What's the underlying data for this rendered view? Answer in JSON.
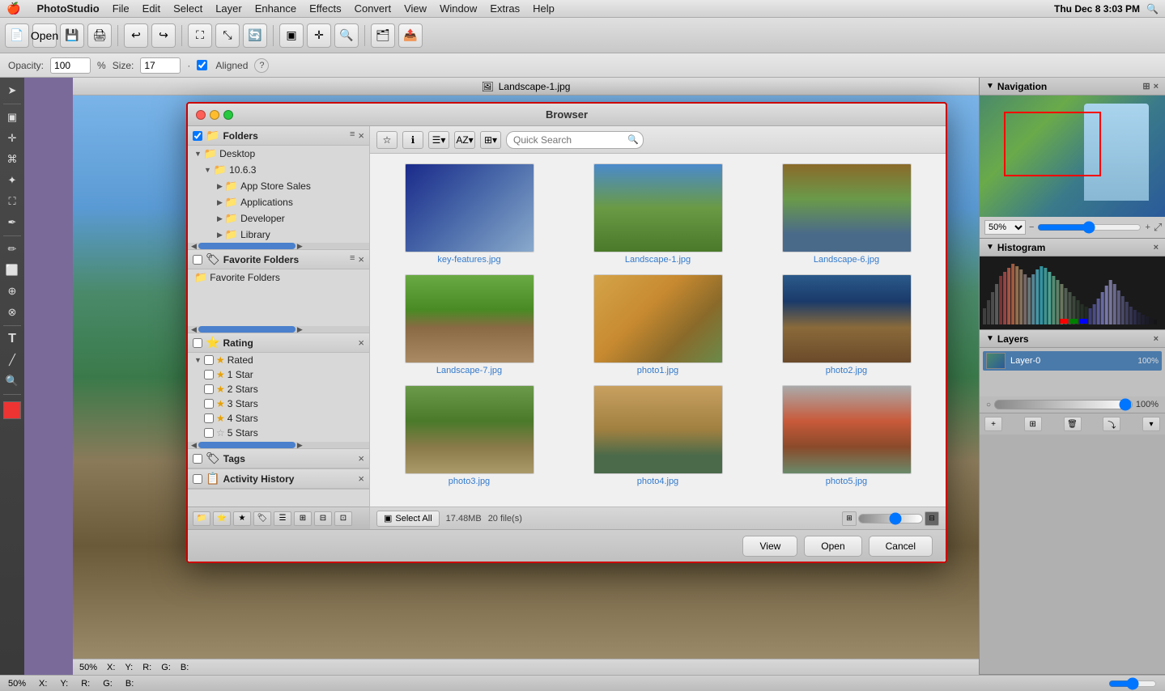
{
  "menubar": {
    "apple": "🍎",
    "items": [
      "PhotoStudio",
      "File",
      "Edit",
      "Select",
      "Layer",
      "Enhance",
      "Effects",
      "Convert",
      "View",
      "Window",
      "Extras",
      "Help"
    ],
    "time": "Thu Dec 8  3:03 PM",
    "search_icon": "🔍"
  },
  "toolbar": {
    "buttons": [
      "📄",
      "💾",
      "🖨",
      "✂",
      "📋",
      "🔄",
      "⬆",
      "⬇",
      "🖼",
      "📤",
      "🗂",
      "📦"
    ]
  },
  "optionsbar": {
    "opacity_label": "Opacity:",
    "opacity_value": "100",
    "pct": "%",
    "size_label": "Size:",
    "size_value": "17",
    "aligned_label": "Aligned",
    "help_icon": "?"
  },
  "canvas": {
    "title": "Landscape-1.jpg",
    "zoom": "50%",
    "x_label": "X:",
    "y_label": "Y:",
    "r_label": "R:",
    "g_label": "G:",
    "b_label": "B:"
  },
  "right_panel": {
    "navigation": {
      "title": "Navigation",
      "zoom": "50%"
    },
    "histogram": {
      "title": "Histogram"
    },
    "layers": {
      "title": "Layers",
      "layer_name": "Layer-0",
      "opacity": "100%"
    }
  },
  "browser": {
    "title": "Browser",
    "sidebar": {
      "folders_panel": {
        "title": "Folders",
        "items": [
          {
            "label": "Desktop",
            "indent": 0,
            "type": "folder"
          },
          {
            "label": "10.6.3",
            "indent": 1,
            "type": "folder"
          },
          {
            "label": "App Store Sales",
            "indent": 2,
            "type": "folder"
          },
          {
            "label": "Applications",
            "indent": 2,
            "type": "folder"
          },
          {
            "label": "Developer",
            "indent": 2,
            "type": "folder"
          },
          {
            "label": "Library",
            "indent": 2,
            "type": "folder"
          }
        ]
      },
      "favorite_folders": {
        "title": "Favorite Folders",
        "item": "Favorite Folders"
      },
      "rating": {
        "title": "Rating",
        "items": [
          "Rated",
          "1 Star",
          "2 Stars",
          "3 Stars",
          "4 Stars",
          "5 Stars"
        ]
      },
      "tags": {
        "title": "Tags"
      },
      "activity_history": {
        "title": "Activity History"
      }
    },
    "toolbar": {
      "search_placeholder": "Quick Search"
    },
    "files": [
      {
        "name": "key-features.jpg",
        "thumb": "keyfeatures"
      },
      {
        "name": "Landscape-1.jpg",
        "thumb": "landscape1"
      },
      {
        "name": "Landscape-6.jpg",
        "thumb": "landscape6"
      },
      {
        "name": "Landscape-7.jpg",
        "thumb": "house"
      },
      {
        "name": "photo1.jpg",
        "thumb": "kids"
      },
      {
        "name": "photo2.jpg",
        "thumb": "pumpkin"
      },
      {
        "name": "photo3.jpg",
        "thumb": "playground"
      },
      {
        "name": "photo4.jpg",
        "thumb": "boy-hat"
      },
      {
        "name": "photo5.jpg",
        "thumb": "boy-red"
      }
    ],
    "footer": {
      "select_all": "Select All",
      "size": "17.48MB",
      "count": "20 file(s)"
    },
    "actions": {
      "view": "View",
      "open": "Open",
      "cancel": "Cancel"
    }
  }
}
